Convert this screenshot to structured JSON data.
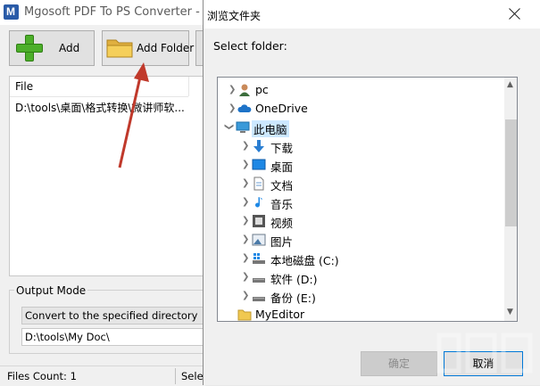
{
  "app": {
    "title": "Mgosoft PDF To PS Converter - Tr",
    "toolbar": {
      "add_label": "Add",
      "add_folder_label": "Add Folder"
    },
    "file_list": {
      "column_header": "File",
      "rows": [
        "D:\\tools\\桌面\\格式转换\\微讲师软..."
      ]
    },
    "output_mode": {
      "label": "Output Mode",
      "selected": "Convert to the specified directory",
      "directory": "D:\\tools\\My Doc\\"
    },
    "status": {
      "files_count": "Files Count: 1",
      "select_text": "Selec"
    }
  },
  "dialog": {
    "title": "浏览文件夹",
    "prompt": "Select folder:",
    "tree": [
      {
        "label": "pc",
        "icon": "user-icon"
      },
      {
        "label": "OneDrive",
        "icon": "cloud-icon"
      },
      {
        "label": "此电脑",
        "icon": "computer-icon",
        "selected": true
      },
      {
        "label": "下载",
        "icon": "download-icon"
      },
      {
        "label": "桌面",
        "icon": "desktop-icon"
      },
      {
        "label": "文档",
        "icon": "document-icon"
      },
      {
        "label": "音乐",
        "icon": "music-icon"
      },
      {
        "label": "视频",
        "icon": "video-icon"
      },
      {
        "label": "图片",
        "icon": "picture-icon"
      },
      {
        "label": "本地磁盘 (C:)",
        "icon": "windows-drive-icon"
      },
      {
        "label": "软件 (D:)",
        "icon": "drive-icon"
      },
      {
        "label": "备份 (E:)",
        "icon": "drive-icon"
      },
      {
        "label": "MyEditor",
        "icon": "folder-icon"
      }
    ],
    "ok_label": "确定",
    "cancel_label": "取消"
  },
  "colors": {
    "accent": "#0078d7",
    "selection": "#cce8ff",
    "arrow": "#c0392b"
  }
}
